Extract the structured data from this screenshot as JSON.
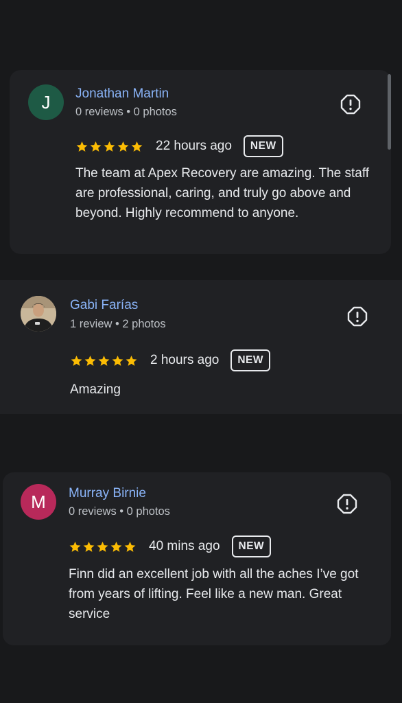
{
  "reviews": [
    {
      "name": "Jonathan Martin",
      "initial": "J",
      "avatar_color": "#1e5a45",
      "meta": "0 reviews • 0 photos",
      "rating": 5,
      "time": "22 hours ago",
      "badge": "NEW",
      "text": "The team at Apex Recovery are amazing. The staff are professional, caring, and truly go above and beyond. Highly recommend to anyone."
    },
    {
      "name": "Gabi Farías",
      "initial": "",
      "avatar_color": "#c9b79a",
      "meta": "1 review • 2 photos",
      "rating": 5,
      "time": "2 hours ago",
      "badge": "NEW",
      "text": "Amazing"
    },
    {
      "name": "Murray Birnie",
      "initial": "M",
      "avatar_color": "#b8295a",
      "meta": "0 reviews • 0 photos",
      "rating": 5,
      "time": "40 mins ago",
      "badge": "NEW",
      "text": "Finn did an excellent job with all the aches I’ve got from years of lifting. Feel like a new man. Great service"
    }
  ],
  "icons": {
    "flag": "report-flag-icon",
    "star": "star-icon"
  },
  "colors": {
    "star": "#fbbc04",
    "name_link": "#8ab4f8"
  }
}
